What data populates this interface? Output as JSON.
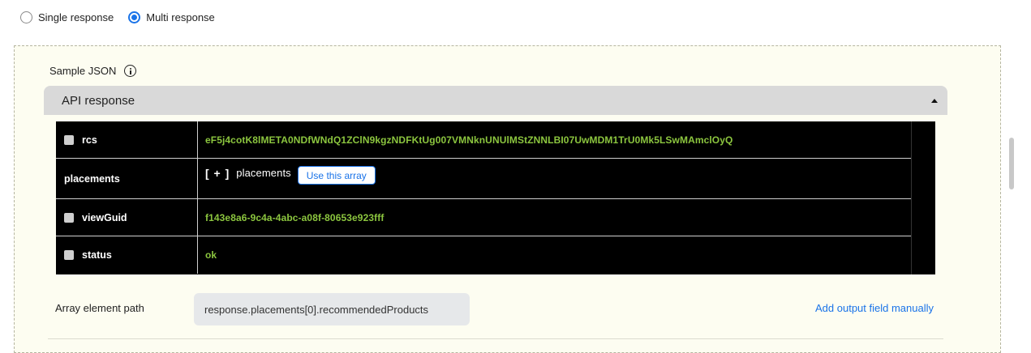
{
  "response_mode": {
    "options": [
      {
        "label": "Single response",
        "selected": false
      },
      {
        "label": "Multi response",
        "selected": true
      }
    ]
  },
  "sample_json": {
    "label": "Sample JSON",
    "info_icon": "info-icon"
  },
  "accordion": {
    "title": "API response",
    "icon": "caret-up-icon"
  },
  "json_rows": [
    {
      "key": "rcs",
      "value": "eF5j4cotK8lMETA0NDfWNdQ1ZClN9kgzNDFKtUg007VMNknUNUlMStZNNLBI07UwMDM1TrU0Mk5LSwMAmclOyQ",
      "checkbox": true
    },
    {
      "key": "placements",
      "bracket": "[ + ]",
      "value": "placements",
      "button": "Use this array"
    },
    {
      "key": "viewGuid",
      "value": "f143e8a6-9c4a-4abc-a08f-80653e923fff",
      "checkbox": true
    },
    {
      "key": "status",
      "value": "ok",
      "checkbox": true
    }
  ],
  "array_path": {
    "label": "Array element path",
    "value": "response.placements[0].recommendedProducts"
  },
  "add_output_link": "Add output field manually",
  "colors": {
    "accent": "#1a73e8",
    "json_value": "#8cc63f",
    "panel_bg": "#fdfdf1"
  }
}
